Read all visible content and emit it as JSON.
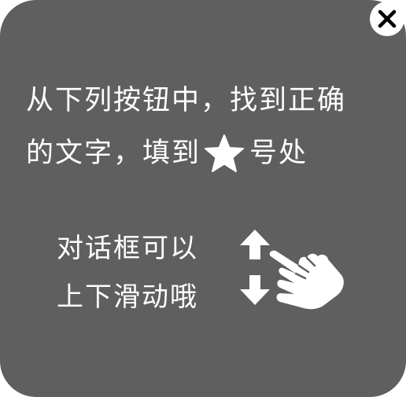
{
  "dialog": {
    "instruction_line1": "从下列按钮中，找到正确",
    "instruction_line2_before": "的文字，填到",
    "instruction_line2_after": "号处",
    "hint_line1": "对话框可以",
    "hint_line2": "上下滑动哦",
    "icons": {
      "close": "close-icon",
      "star": "star-icon",
      "scroll": "scroll-up-down-hand-icon"
    },
    "colors": {
      "background": "#5f5f5f",
      "text": "#ffffff"
    }
  }
}
